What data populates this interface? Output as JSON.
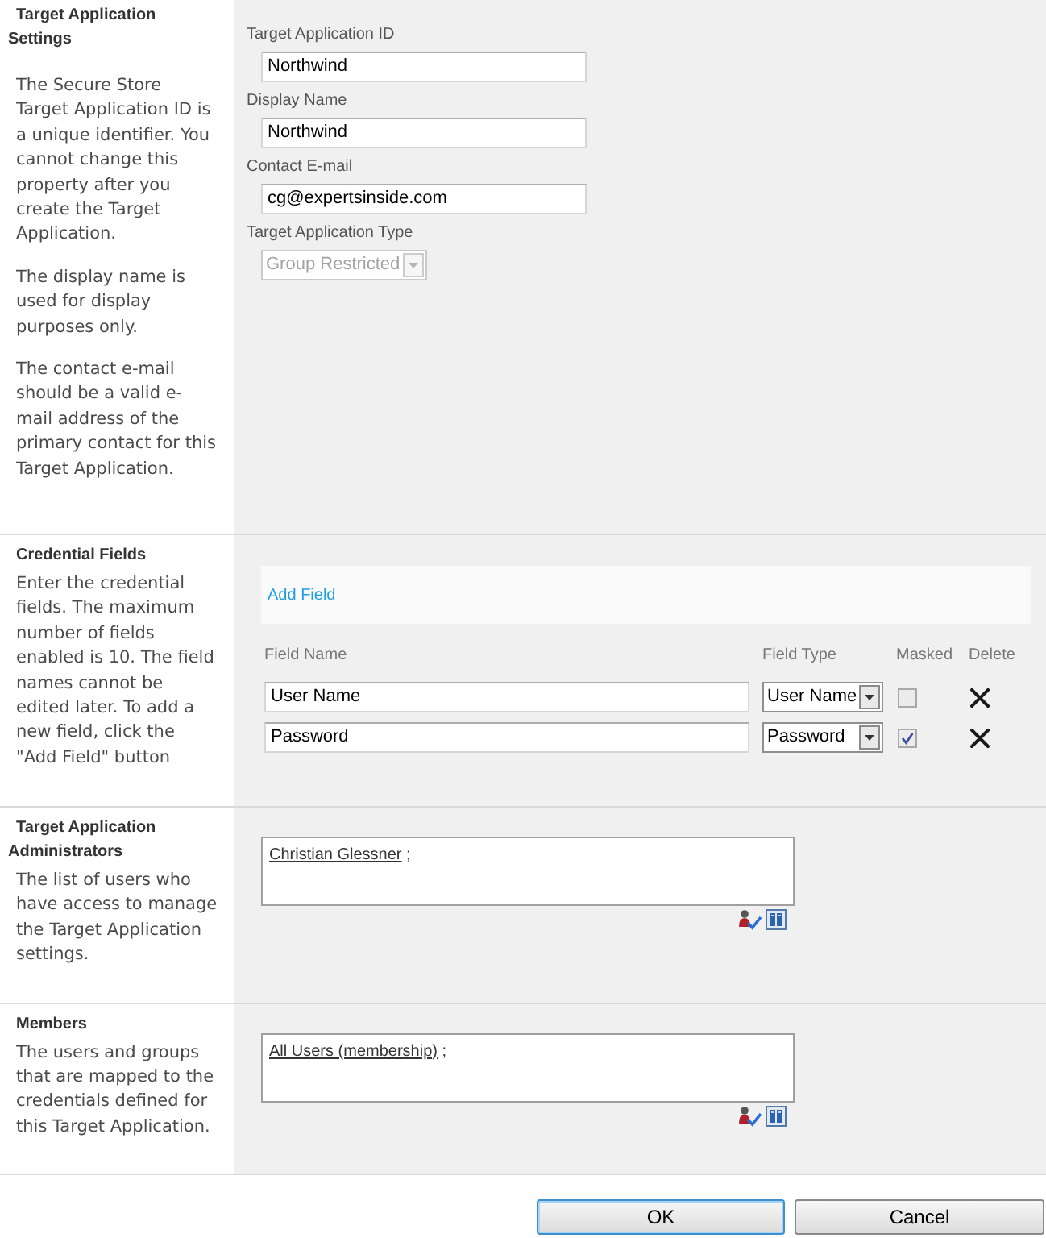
{
  "sections": [
    {
      "kind": "settings",
      "title": "Target Application Settings",
      "description": [
        "The Secure Store Target Application ID is a unique identifier. You cannot change this property after you create the Target Application.",
        "The display name is used for display purposes only.",
        "The contact e-mail should be a valid e-mail address of the primary contact for this Target Application."
      ],
      "fields": [
        {
          "kind": "text",
          "label": "Target Application ID",
          "value": "Northwind",
          "disabled": false
        },
        {
          "kind": "text",
          "label": "Display Name",
          "value": "Northwind",
          "disabled": false
        },
        {
          "kind": "text",
          "label": "Contact E-mail",
          "value": "cg@expertsinside.com",
          "disabled": false
        },
        {
          "kind": "select",
          "label": "Target Application Type",
          "value": "Group Restricted",
          "disabled": true
        }
      ]
    },
    {
      "kind": "credentials",
      "title": "Credential Fields",
      "description": [
        "Enter the credential fields. The maximum number of fields enabled is 10. The field names cannot be edited later. To add a new field, click the \"Add Field\" button"
      ],
      "add_link": "Add Field",
      "columns": [
        "Field Name",
        "Field Type",
        "Masked",
        "Delete"
      ],
      "rows": [
        {
          "name": "User Name",
          "type": "User Name",
          "masked": false
        },
        {
          "name": "Password",
          "type": "Password",
          "masked": true
        }
      ]
    },
    {
      "kind": "people",
      "title": "Target Application Administrators",
      "description": [
        "The list of users who have access to manage the Target Application settings."
      ],
      "entries": [
        {
          "name": "Christian Glessner",
          "separator": ";"
        }
      ]
    },
    {
      "kind": "people",
      "title": "Members",
      "description": [
        "The users and groups that are mapped to the credentials defined for this Target Application."
      ],
      "entries": [
        {
          "name": "All Users (membership)",
          "separator": ";"
        }
      ]
    }
  ],
  "buttons": [
    {
      "label": "OK",
      "focused": true
    },
    {
      "label": "Cancel",
      "focused": false
    }
  ]
}
